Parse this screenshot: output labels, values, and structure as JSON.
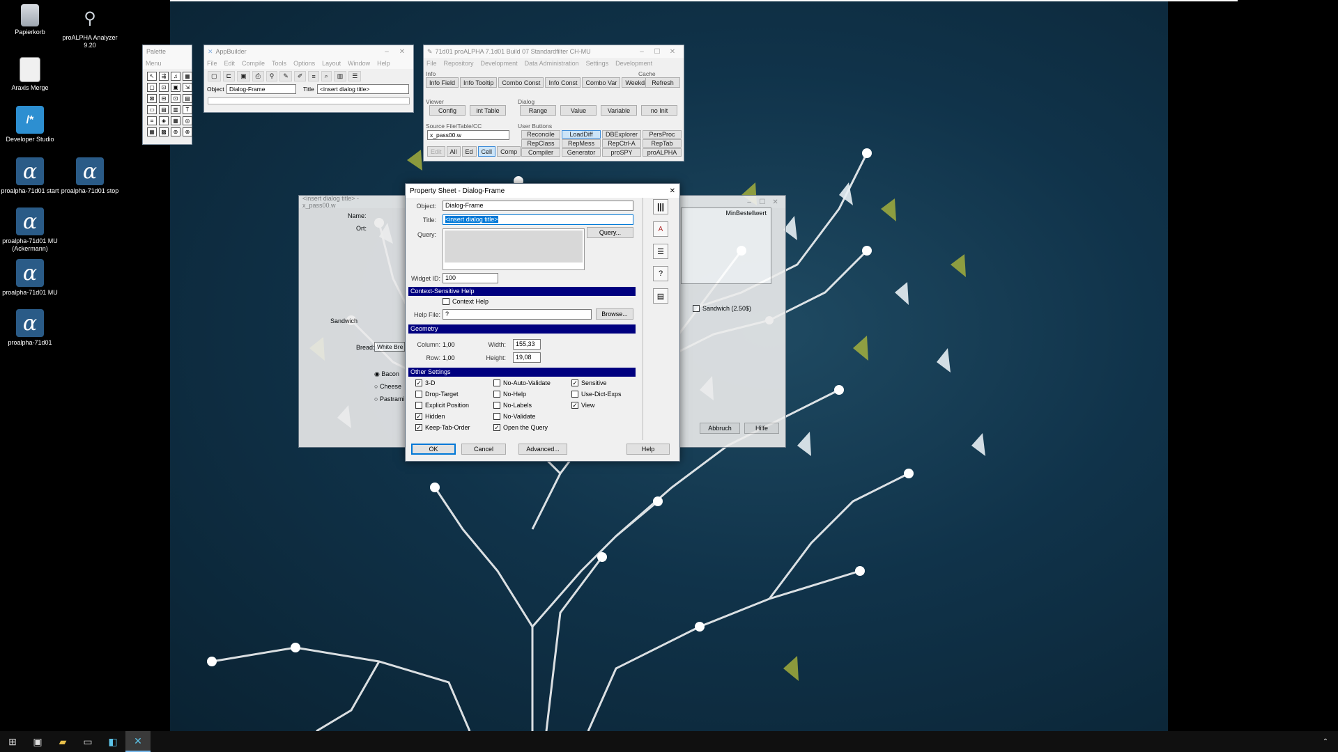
{
  "desktop": {
    "icons": [
      {
        "label": "Papierkorb",
        "icon": "recycle-bin-icon"
      },
      {
        "label": "proALPHA Analyzer 9.20",
        "icon": "analyzer-icon"
      },
      {
        "label": "Araxis Merge",
        "icon": "document-icon"
      },
      {
        "label": "Developer Studio",
        "icon": "developer-studio-icon"
      },
      {
        "label": "proalpha-71d01 start",
        "icon": "proalpha-icon",
        "glyph": "α"
      },
      {
        "label": "proalpha-71d01 stop",
        "icon": "proalpha-icon",
        "glyph": "α"
      },
      {
        "label": "proalpha-71d01 MU (Ackermann)",
        "icon": "proalpha-icon",
        "glyph": "α"
      },
      {
        "label": "proalpha-71d01 MU",
        "icon": "proalpha-icon",
        "glyph": "α"
      },
      {
        "label": "proalpha-71d01",
        "icon": "proalpha-icon",
        "glyph": "α"
      }
    ]
  },
  "palette": {
    "title": "Palette",
    "menu": "Menu",
    "tools": [
      "↖",
      "⇶",
      "♫",
      "▦",
      "▢",
      "⊡",
      "▣",
      "⇲",
      "⊠",
      "⊟",
      "⊡",
      "▤",
      "▭",
      "▤",
      "▥",
      "T",
      "⌗",
      "◈",
      "▦",
      "◎",
      "▦",
      "▩",
      "⊕",
      "⊗"
    ]
  },
  "appbuilder": {
    "title": "AppBuilder",
    "menu": [
      "File",
      "Edit",
      "Compile",
      "Tools",
      "Options",
      "Layout",
      "Window",
      "Help"
    ],
    "object_label": "Object",
    "object_value": "Dialog-Frame",
    "title_label": "Title",
    "title_value": "<insert dialog title>"
  },
  "proalpha": {
    "title": "71d01 proALPHA 7.1d01 Build 07 Standardfilter CH-MU",
    "menu": [
      "File",
      "Repository",
      "Development",
      "Data Administration",
      "Settings",
      "Development"
    ],
    "info_label": "Info",
    "cache_label": "Cache",
    "info_buttons": [
      "Info Field",
      "Info Tooltip",
      "Combo Const",
      "Info Const",
      "Combo Var",
      "Weekday"
    ],
    "refresh": "Refresh",
    "viewer_label": "Viewer",
    "dialog_label": "Dialog",
    "viewer_buttons": [
      "Config",
      "int Table"
    ],
    "dialog_buttons": [
      "Range",
      "Value",
      "Variable",
      "no Init"
    ],
    "source_label": "Source File/Table/CC",
    "user_buttons_label": "User Buttons",
    "source_value": "x_pass00.w",
    "source_buttons": [
      "Edit",
      "All",
      "Ed",
      "Cell",
      "Comp"
    ],
    "user_buttons": [
      "Reconcile",
      "LoadDiff",
      "DBExplorer",
      "PersProc",
      "RepClass",
      "RepMess",
      "RepCtrl-A",
      "RepTab",
      "Compiler",
      "Generator",
      "proSPY",
      "proALPHA"
    ]
  },
  "bg_dialog": {
    "title": "<insert dialog title> - x_pass00.w",
    "name_label": "Name:",
    "ort_label": "Ort:",
    "sandwich_label": "Sandwich",
    "bread_label": "Bread:",
    "bread_value": "White Bre",
    "radios": [
      "Bacon",
      "Cheese",
      "Pastrami"
    ],
    "col_header": "MinBestellwert",
    "sandwich_cb": "Sandwich (2.50$)",
    "abbruch": "Abbruch",
    "hilfe": "Hilfe"
  },
  "property_sheet": {
    "title": "Property Sheet - Dialog-Frame",
    "object_label": "Object:",
    "object_value": "Dialog-Frame",
    "title_label": "Title:",
    "title_value": "<insert dialog title>",
    "query_label": "Query:",
    "query_button": "Query...",
    "widget_id_label": "Widget ID:",
    "widget_id_value": "100",
    "context_help_header": "Context-Sensitive Help",
    "context_help_cb": "Context Help",
    "help_file_label": "Help File:",
    "help_file_value": "?",
    "browse_button": "Browse...",
    "geometry_header": "Geometry",
    "column_label": "Column:",
    "column_value": "1,00",
    "row_label": "Row:",
    "row_value": "1,00",
    "width_label": "Width:",
    "width_value": "155,33",
    "height_label": "Height:",
    "height_value": "19,08",
    "other_header": "Other Settings",
    "settings": [
      {
        "label": "3-D",
        "checked": true
      },
      {
        "label": "No-Auto-Validate",
        "checked": false
      },
      {
        "label": "Sensitive",
        "checked": true
      },
      {
        "label": "Drop-Target",
        "checked": false
      },
      {
        "label": "No-Help",
        "checked": false
      },
      {
        "label": "Use-Dict-Exps",
        "checked": false
      },
      {
        "label": "Explicit Position",
        "checked": false
      },
      {
        "label": "No-Labels",
        "checked": false
      },
      {
        "label": "View",
        "checked": true
      },
      {
        "label": "Hidden",
        "checked": true
      },
      {
        "label": "No-Validate",
        "checked": false
      },
      {
        "label": "",
        "checked": false
      },
      {
        "label": "Keep-Tab-Order",
        "checked": true
      },
      {
        "label": "Open the Query",
        "checked": true
      },
      {
        "label": "",
        "checked": false
      }
    ],
    "ok": "OK",
    "cancel": "Cancel",
    "advanced": "Advanced...",
    "help": "Help",
    "side_icons": [
      "columns-icon",
      "font-color-icon",
      "list-icon",
      "help-bubble-icon",
      "properties-icon"
    ]
  },
  "taskbar": {
    "items": [
      "start-icon",
      "task-view-icon",
      "file-explorer-icon",
      "terminal-icon",
      "developer-studio-icon",
      "appbuilder-icon"
    ]
  },
  "colors": {
    "section_header": "#00007f",
    "selection": "#0078d7",
    "wallpaper": "#10334a"
  }
}
